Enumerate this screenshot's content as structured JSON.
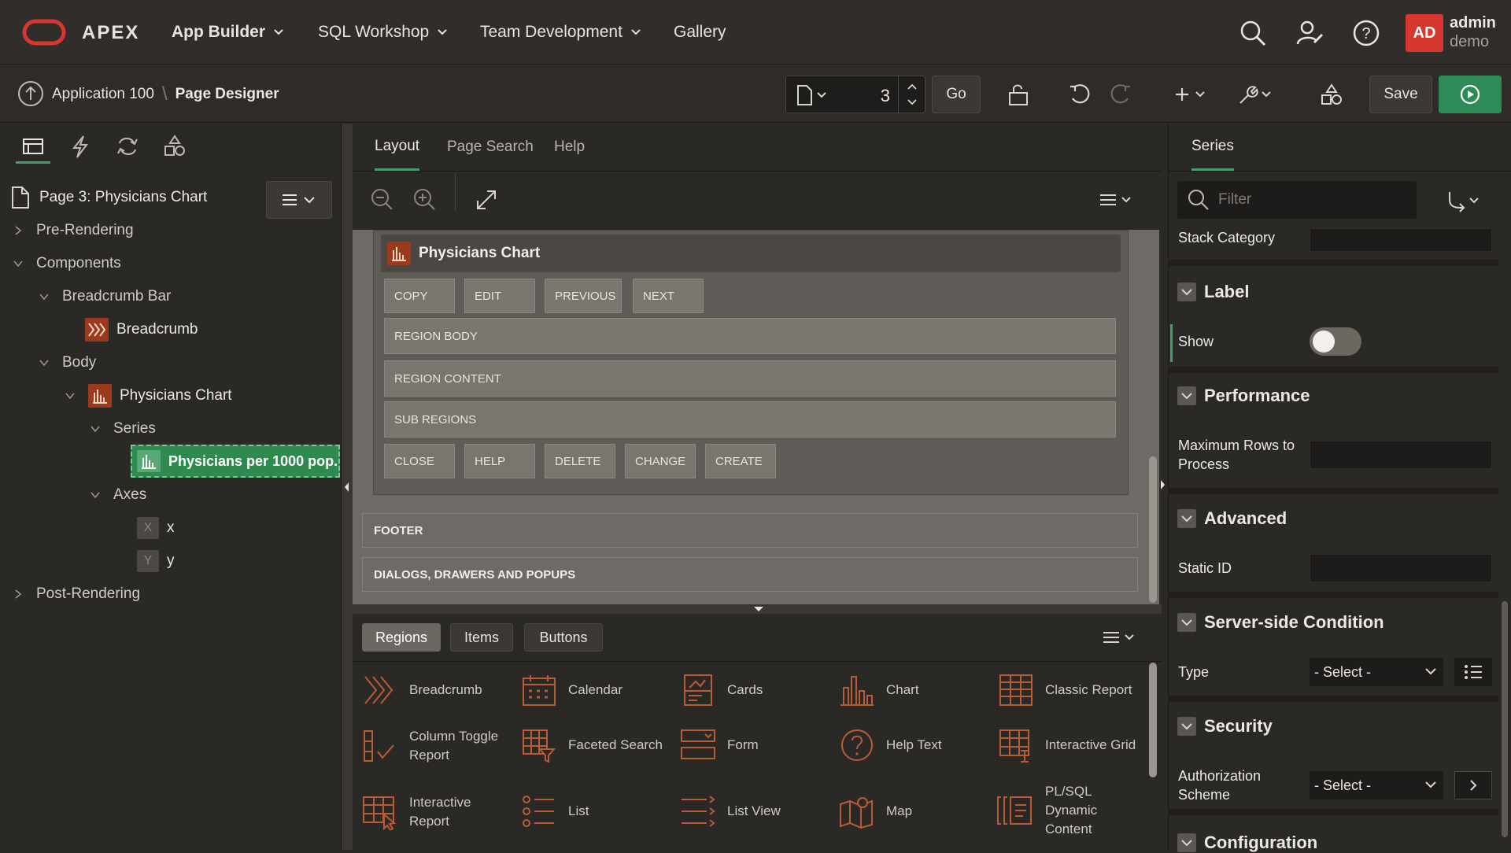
{
  "topbar": {
    "brand": "APEX",
    "nav": [
      {
        "label": "App Builder",
        "active": true
      },
      {
        "label": "SQL Workshop",
        "active": false
      },
      {
        "label": "Team Development",
        "active": false
      },
      {
        "label": "Gallery",
        "active": false
      }
    ],
    "user": {
      "initials": "AD",
      "name": "admin",
      "workspace": "demo"
    }
  },
  "toolbar": {
    "breadcrumb": [
      "Application 100",
      "Page Designer"
    ],
    "page_number": "3",
    "go_label": "Go",
    "save_label": "Save"
  },
  "left": {
    "page_title": "Page 3: Physicians Chart",
    "tree": {
      "pre_rendering": "Pre-Rendering",
      "components": "Components",
      "breadcrumb_bar": "Breadcrumb Bar",
      "breadcrumb": "Breadcrumb",
      "body": "Body",
      "physicians_chart": "Physicians Chart",
      "series": "Series",
      "series_item": "Physicians per 1000 pop.",
      "axes": "Axes",
      "axis_x": "x",
      "axis_y": "y",
      "post_rendering": "Post-Rendering"
    }
  },
  "middle": {
    "tabs": [
      "Layout",
      "Page Search",
      "Help"
    ],
    "region_title": "Physicians Chart",
    "top_buttons": [
      "COPY",
      "EDIT",
      "PREVIOUS",
      "NEXT"
    ],
    "rows": [
      "REGION BODY",
      "REGION CONTENT",
      "SUB REGIONS"
    ],
    "bottom_buttons": [
      "CLOSE",
      "HELP",
      "DELETE",
      "CHANGE",
      "CREATE"
    ],
    "footer": "FOOTER",
    "dialogs": "DIALOGS, DRAWERS AND POPUPS",
    "gallery_tabs": [
      "Regions",
      "Items",
      "Buttons"
    ],
    "gallery": [
      {
        "label": "Breadcrumb",
        "icon": "breadcrumb-icon"
      },
      {
        "label": "Calendar",
        "icon": "calendar-icon"
      },
      {
        "label": "Cards",
        "icon": "cards-icon"
      },
      {
        "label": "Chart",
        "icon": "chart-icon"
      },
      {
        "label": "Classic Report",
        "icon": "classic-report-icon"
      },
      {
        "label": "Column Toggle Report",
        "icon": "column-toggle-icon"
      },
      {
        "label": "Faceted Search",
        "icon": "faceted-search-icon"
      },
      {
        "label": "Form",
        "icon": "form-icon"
      },
      {
        "label": "Help Text",
        "icon": "help-text-icon"
      },
      {
        "label": "Interactive Grid",
        "icon": "interactive-grid-icon"
      },
      {
        "label": "Interactive Report",
        "icon": "interactive-report-icon"
      },
      {
        "label": "List",
        "icon": "list-icon"
      },
      {
        "label": "List View",
        "icon": "list-view-icon"
      },
      {
        "label": "Map",
        "icon": "map-icon"
      },
      {
        "label": "PL/SQL Dynamic Content",
        "icon": "plsql-icon"
      }
    ]
  },
  "right": {
    "tab": "Series",
    "filter_placeholder": "Filter",
    "stack_category": "Stack Category",
    "label_section": "Label",
    "show": "Show",
    "performance": "Performance",
    "max_rows": "Maximum Rows to Process",
    "advanced": "Advanced",
    "static_id": "Static ID",
    "server_condition": "Server-side Condition",
    "type": "Type",
    "select_placeholder": "- Select -",
    "security": "Security",
    "authorization": "Authorization Scheme",
    "configuration": "Configuration"
  },
  "colors": {
    "accent_green": "#2e8b57",
    "brand_red": "#d6382f",
    "selected_green": "#2f8a4f"
  }
}
